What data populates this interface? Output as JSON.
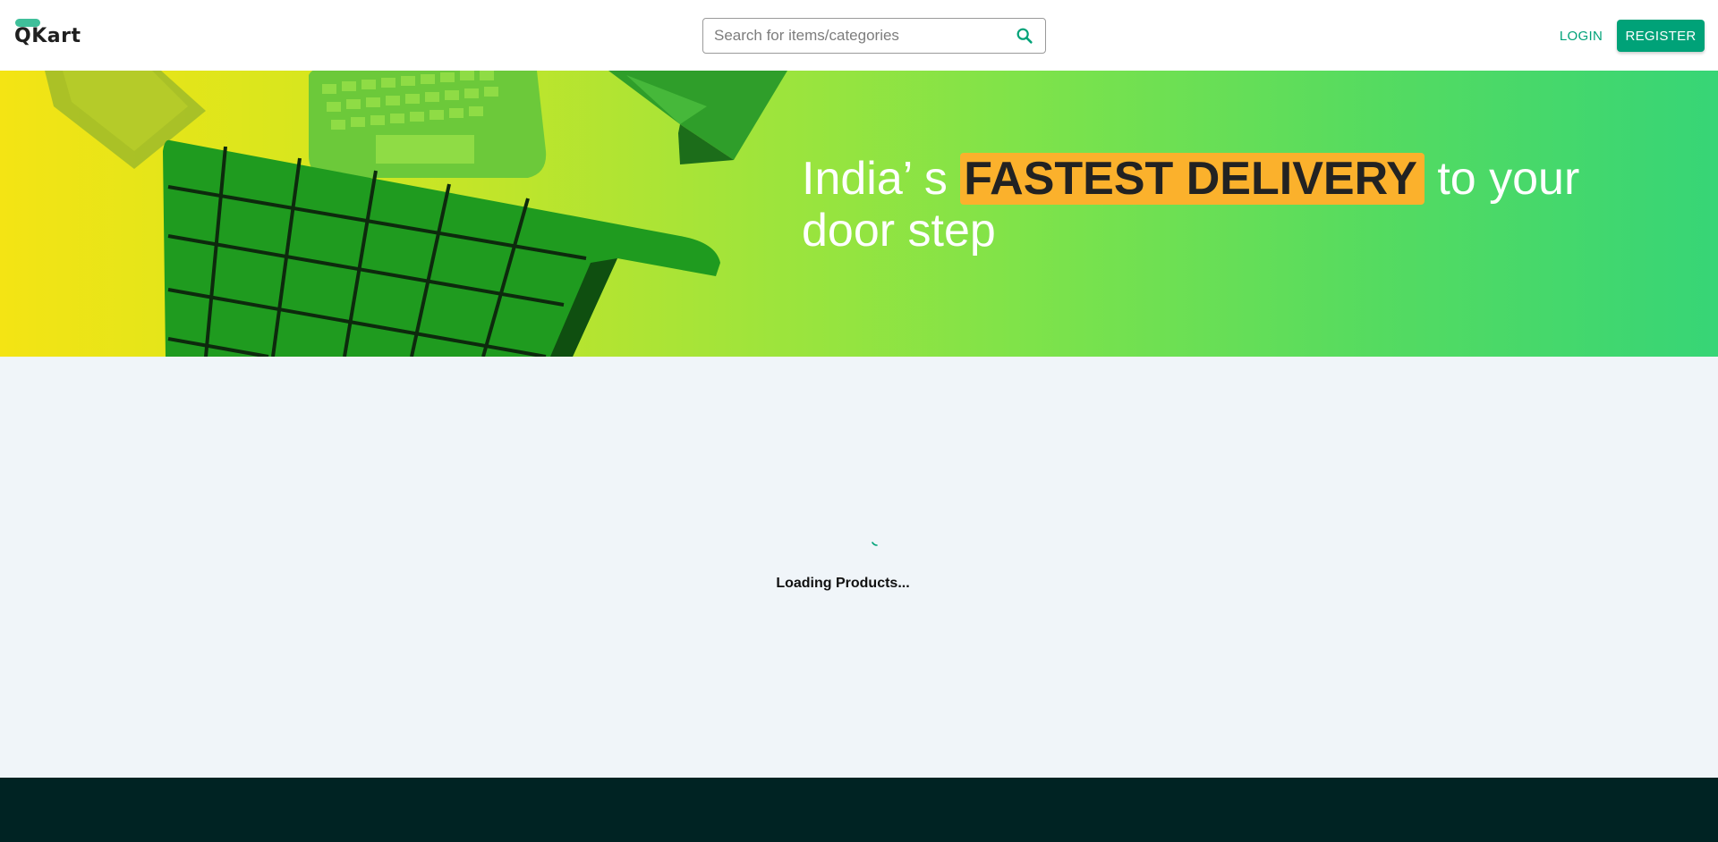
{
  "header": {
    "logo_text": "QKart",
    "search": {
      "placeholder": "Search for items/categories",
      "value": "",
      "icon": "search-icon"
    },
    "login_label": "LOGIN",
    "register_label": "REGISTER"
  },
  "hero": {
    "text_before": "India’ s ",
    "highlight": "FASTEST DELIVERY",
    "text_after": " to your door step"
  },
  "loading": {
    "text": "Loading Products..."
  },
  "colors": {
    "accent": "#00a278",
    "highlight": "#fbb12c",
    "footer": "#002323",
    "page_bg": "#f0f5f9"
  }
}
